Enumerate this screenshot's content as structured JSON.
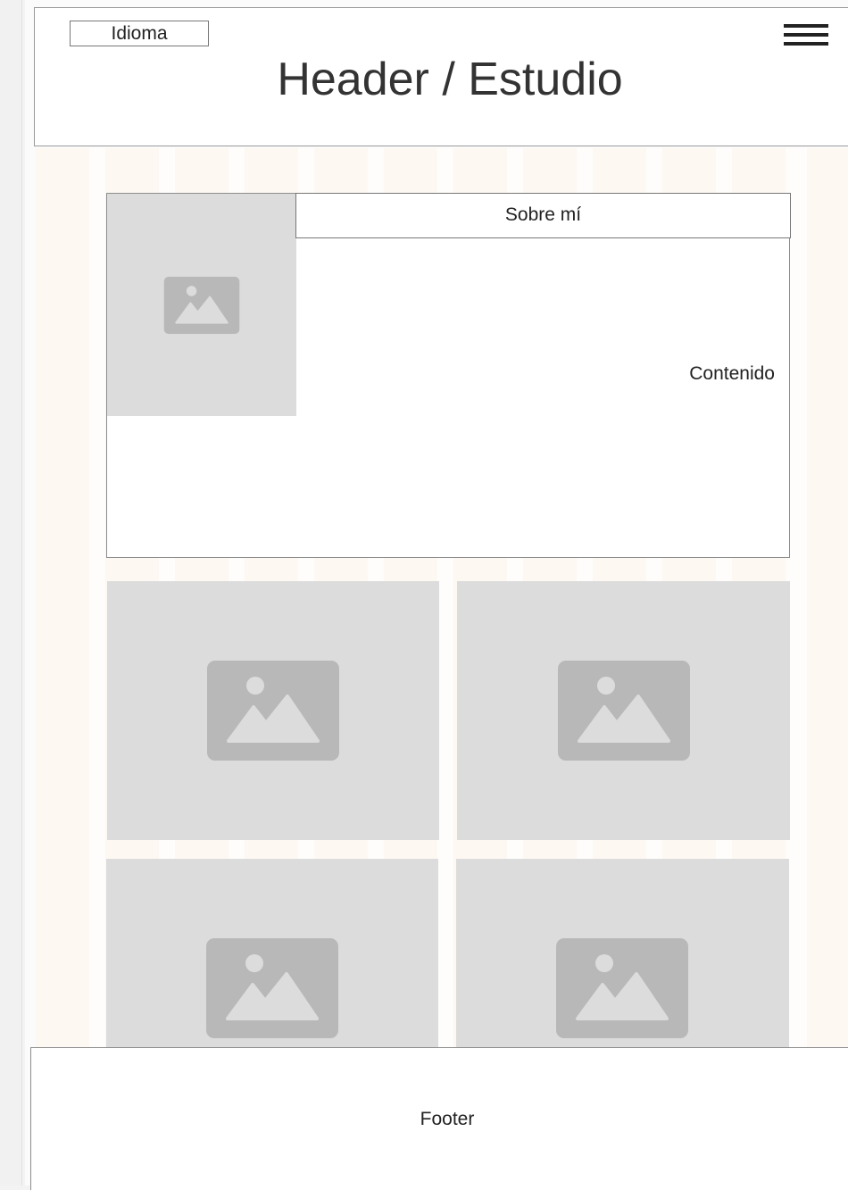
{
  "header": {
    "language_button": "Idioma",
    "title": "Header / Estudio",
    "menu_icon": "hamburger-menu-icon"
  },
  "about": {
    "tab_label": "Sobre mí",
    "content_label": "Contenido",
    "image_icon": "image-placeholder-icon"
  },
  "gallery": {
    "tiles": [
      {
        "icon": "image-placeholder-icon"
      },
      {
        "icon": "image-placeholder-icon"
      },
      {
        "icon": "image-placeholder-icon"
      },
      {
        "icon": "image-placeholder-icon"
      }
    ]
  },
  "footer": {
    "label": "Footer"
  },
  "colors": {
    "placeholder_fill": "#dcdcdc",
    "placeholder_icon": "#b8b8b8",
    "column_guides": "#fdf8f2",
    "border": "#8d8d8d"
  }
}
